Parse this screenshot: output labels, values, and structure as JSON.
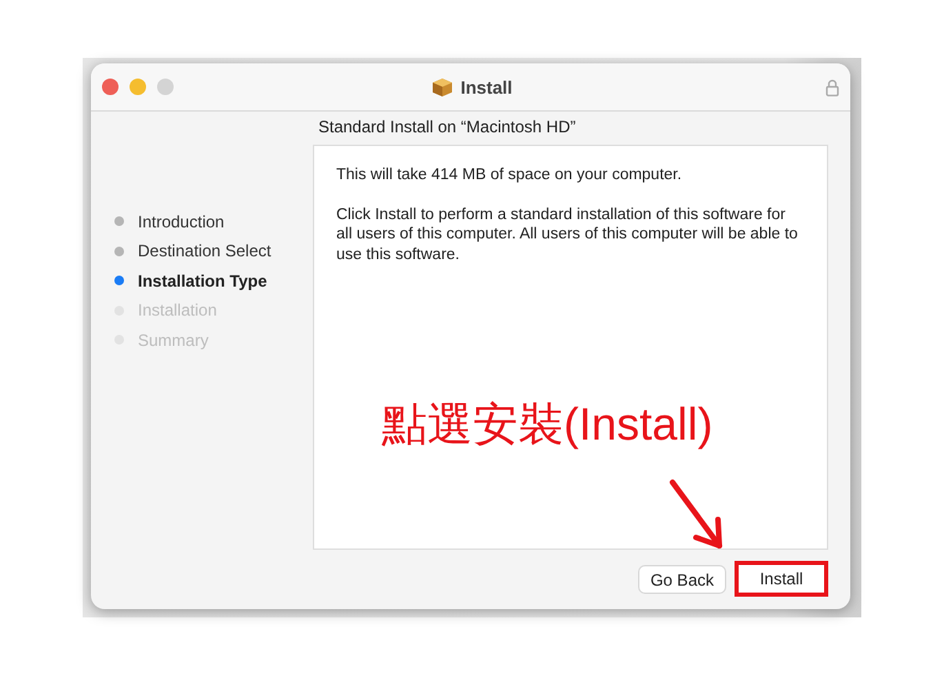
{
  "window": {
    "title": "Install",
    "locked": true
  },
  "heading": "Standard Install on “Macintosh HD”",
  "steps": [
    {
      "label": "Introduction",
      "kind": "done"
    },
    {
      "label": "Destination Select",
      "kind": "done"
    },
    {
      "label": "Installation Type",
      "kind": "current"
    },
    {
      "label": "Installation",
      "kind": "pending"
    },
    {
      "label": "Summary",
      "kind": "pending"
    }
  ],
  "message": [
    "This will take 414 MB of space on your computer.",
    "Click Install to perform a standard installation of this software for all users of this computer. All users of this computer will be able to use this software."
  ],
  "buttons": [
    {
      "label": "Go Back",
      "highlighted": false
    },
    {
      "label": "Install",
      "highlighted": true
    }
  ],
  "annotation": {
    "text": "點選安裝(Install)"
  }
}
